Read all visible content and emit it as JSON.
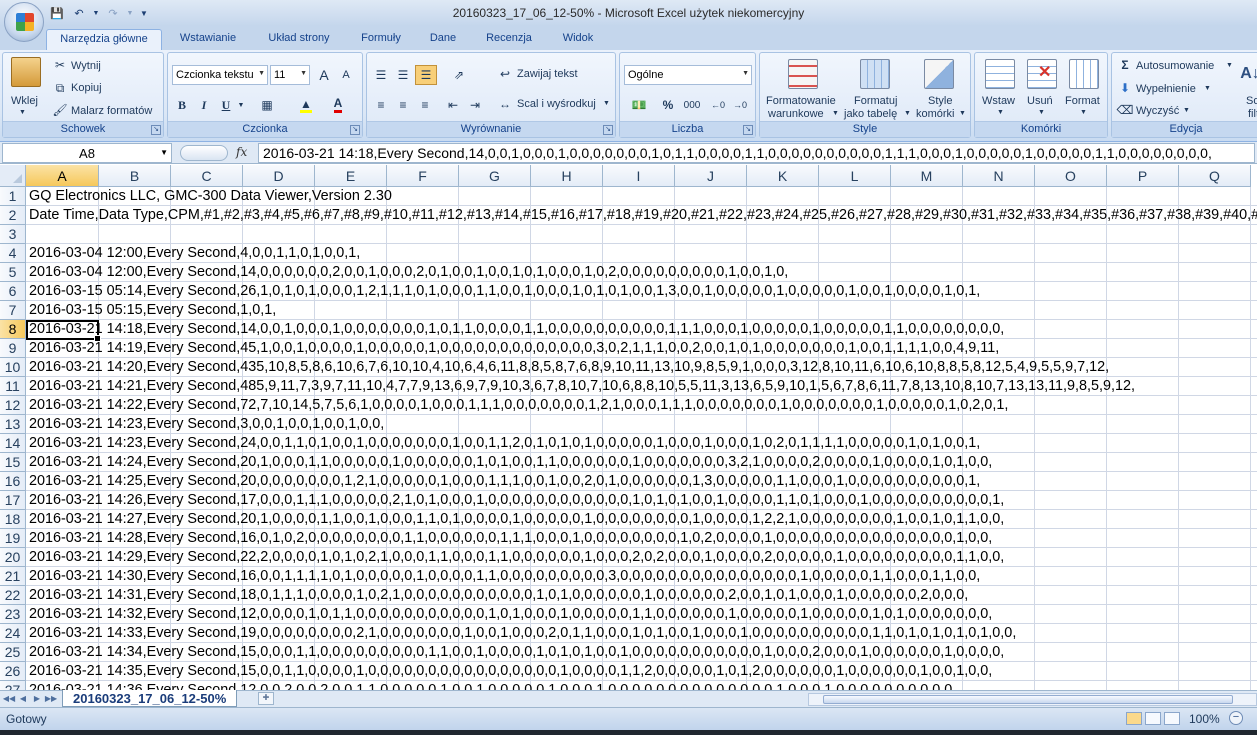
{
  "window": {
    "title": "20160323_17_06_12-50% - Microsoft Excel użytek niekomercyjny"
  },
  "quick_access": {
    "save_icon": "save-icon",
    "undo_icon": "undo-icon",
    "redo_icon": "redo-icon",
    "customize_icon": "customize-qat-icon"
  },
  "ribbon_tabs": [
    {
      "label": "Narzędzia główne",
      "active": true
    },
    {
      "label": "Wstawianie"
    },
    {
      "label": "Układ strony"
    },
    {
      "label": "Formuły"
    },
    {
      "label": "Dane"
    },
    {
      "label": "Recenzja"
    },
    {
      "label": "Widok"
    }
  ],
  "ribbon": {
    "clipboard": {
      "group_label": "Schowek",
      "paste": "Wklej",
      "cut": "Wytnij",
      "copy": "Kopiuj",
      "format_painter": "Malarz formatów"
    },
    "font": {
      "group_label": "Czcionka",
      "font_name": "Czcionka tekstu",
      "font_size": "11",
      "bold": "B",
      "italic": "I",
      "underline": "U",
      "grow": "A",
      "shrink": "A",
      "font_color": "A",
      "font_color_hex": "#e00000",
      "fill_color_hex": "#ffff00"
    },
    "alignment": {
      "group_label": "Wyrównanie",
      "wrap_text": "Zawijaj tekst",
      "merge_center": "Scal i wyśrodkuj"
    },
    "number": {
      "group_label": "Liczba",
      "format": "Ogólne",
      "percent": "%",
      "thousands": "000"
    },
    "styles": {
      "group_label": "Style",
      "conditional_line1": "Formatowanie",
      "conditional_line2": "warunkowe",
      "table_line1": "Formatuj",
      "table_line2": "jako tabelę",
      "cell_styles_line1": "Style",
      "cell_styles_line2": "komórki"
    },
    "cells": {
      "group_label": "Komórki",
      "insert": "Wstaw",
      "delete": "Usuń",
      "format": "Format"
    },
    "editing": {
      "group_label": "Edycja",
      "autosum": "Autosumowanie",
      "fill": "Wypełnienie",
      "clear": "Wyczyść",
      "sort_line1": "Sort",
      "sort_line2": "filtr"
    }
  },
  "formula_bar": {
    "name_box": "A8",
    "fx": "fx",
    "formula": "2016-03-21 14:18,Every Second,14,0,0,1,0,0,0,1,0,0,0,0,0,0,0,1,0,1,1,0,0,0,0,1,1,0,0,0,0,0,0,0,0,0,0,1,1,1,0,0,0,1,0,0,0,0,0,1,0,0,0,0,0,1,1,0,0,0,0,0,0,0,0,"
  },
  "columns": [
    "A",
    "B",
    "C",
    "D",
    "E",
    "F",
    "G",
    "H",
    "I",
    "J",
    "K",
    "L",
    "M",
    "N",
    "O",
    "P",
    "Q"
  ],
  "selected_column": "A",
  "selected_row": "8",
  "rows": [
    {
      "n": "1",
      "text": "GQ Electronics LLC, GMC-300 Data Viewer,Version 2.30"
    },
    {
      "n": "2",
      "text": "Date Time,Data Type,CPM,#1,#2,#3,#4,#5,#6,#7,#8,#9,#10,#11,#12,#13,#14,#15,#16,#17,#18,#19,#20,#21,#22,#23,#24,#25,#26,#27,#28,#29,#30,#31,#32,#33,#34,#35,#36,#37,#38,#39,#40,#"
    },
    {
      "n": "3",
      "text": ""
    },
    {
      "n": "4",
      "text": "2016-03-04 12:00,Every Second,4,0,0,1,1,0,1,0,0,1,"
    },
    {
      "n": "5",
      "text": "2016-03-04 12:00,Every Second,14,0,0,0,0,0,0,2,0,0,1,0,0,0,2,0,1,0,0,1,0,0,1,0,1,0,0,0,1,0,2,0,0,0,0,0,0,0,0,0,1,0,0,1,0,"
    },
    {
      "n": "6",
      "text": "2016-03-15 05:14,Every Second,26,1,0,1,0,1,0,0,0,1,2,1,1,1,0,1,0,0,0,1,1,0,0,1,0,0,0,1,0,1,0,1,0,0,1,3,0,0,1,0,0,0,0,0,1,0,0,0,0,0,1,0,0,1,0,0,0,0,1,0,1,"
    },
    {
      "n": "7",
      "text": "2016-03-15 05:15,Every Second,1,0,1,"
    },
    {
      "n": "8",
      "text": "2016-03-21 14:18,Every Second,14,0,0,1,0,0,0,1,0,0,0,0,0,0,0,1,0,1,1,0,0,0,0,1,1,0,0,0,0,0,0,0,0,0,0,1,1,1,0,0,0,1,0,0,0,0,0,1,0,0,0,0,0,1,1,0,0,0,0,0,0,0,0,"
    },
    {
      "n": "9",
      "text": "2016-03-21 14:19,Every Second,45,1,0,0,1,0,0,0,0,1,0,0,0,0,0,1,0,0,0,0,0,0,0,0,0,0,0,0,0,3,0,2,1,1,1,0,0,2,0,0,1,0,1,0,0,0,0,0,0,0,1,0,0,1,1,1,1,0,0,4,9,11,"
    },
    {
      "n": "10",
      "text": "2016-03-21 14:20,Every Second,435,10,8,5,8,6,10,6,7,6,10,10,4,10,6,4,6,11,8,8,5,8,7,6,8,9,10,11,13,10,9,8,5,9,1,0,0,0,3,12,8,10,11,6,10,6,10,8,8,5,8,12,5,4,9,5,5,9,7,12,"
    },
    {
      "n": "11",
      "text": "2016-03-21 14:21,Every Second,485,9,11,7,3,9,7,11,10,4,7,7,9,13,6,9,7,9,10,3,6,7,8,10,7,10,6,8,8,10,5,5,11,3,13,6,5,9,10,1,5,6,7,8,6,11,7,8,13,10,8,10,7,13,13,11,9,8,5,9,12,"
    },
    {
      "n": "12",
      "text": "2016-03-21 14:22,Every Second,72,7,10,14,5,7,5,6,1,0,0,0,0,1,0,0,0,1,1,1,0,0,0,0,0,0,0,1,2,1,0,0,0,1,1,1,0,0,0,0,0,0,0,1,0,0,0,0,0,0,0,1,0,0,0,0,0,1,0,2,0,1,"
    },
    {
      "n": "13",
      "text": "2016-03-21 14:23,Every Second,3,0,0,1,0,0,1,0,0,1,0,0,"
    },
    {
      "n": "14",
      "text": "2016-03-21 14:23,Every Second,24,0,0,1,1,0,1,0,0,1,0,0,0,0,0,0,0,1,0,0,1,1,2,0,1,0,1,0,1,0,0,0,0,0,1,0,0,0,1,0,0,0,1,0,2,0,1,1,1,1,0,0,0,0,0,1,0,1,0,0,1,"
    },
    {
      "n": "15",
      "text": "2016-03-21 14:24,Every Second,20,1,0,0,0,1,1,0,0,0,0,0,1,0,0,0,0,0,0,1,0,1,0,0,1,1,0,0,0,0,0,0,1,0,0,0,0,0,0,0,3,2,1,0,0,0,0,2,0,0,0,0,1,0,0,0,0,1,0,1,0,0,"
    },
    {
      "n": "16",
      "text": "2016-03-21 14:25,Every Second,20,0,0,0,0,0,0,0,1,2,1,0,0,0,0,0,1,0,0,0,1,1,1,0,0,1,0,0,2,0,1,0,0,0,0,0,0,1,3,0,0,0,0,0,1,1,0,0,0,1,0,0,0,0,0,0,0,0,0,0,1,"
    },
    {
      "n": "17",
      "text": "2016-03-21 14:26,Every Second,17,0,0,0,1,1,1,0,0,0,0,0,2,1,0,1,0,0,0,1,0,0,0,0,0,0,0,0,0,0,0,0,1,0,1,0,1,0,0,1,0,0,0,0,1,1,0,1,0,0,0,1,0,0,0,0,0,0,0,0,0,0,1,"
    },
    {
      "n": "18",
      "text": "2016-03-21 14:27,Every Second,20,1,0,0,0,0,1,1,0,0,1,0,0,0,1,1,0,1,0,0,0,0,1,0,0,0,0,0,1,0,0,0,0,0,0,0,0,1,0,0,0,0,1,2,2,1,0,0,0,0,0,0,0,0,1,0,0,1,0,1,1,0,0,"
    },
    {
      "n": "19",
      "text": "2016-03-21 14:28,Every Second,16,0,1,0,2,0,0,0,0,0,0,0,0,1,1,0,0,0,0,0,0,1,1,1,0,0,0,1,0,0,0,0,0,0,0,0,1,0,2,0,0,0,0,1,0,0,0,0,0,0,0,0,0,0,0,0,0,0,0,1,0,0,"
    },
    {
      "n": "20",
      "text": "2016-03-21 14:29,Every Second,22,2,0,0,0,0,1,0,1,0,2,1,0,0,0,1,1,0,0,0,1,1,0,0,0,0,0,0,1,0,0,0,2,0,2,0,0,0,1,0,0,0,0,2,0,0,0,0,0,1,0,0,0,0,0,0,0,0,0,1,1,0,0,"
    },
    {
      "n": "21",
      "text": "2016-03-21 14:30,Every Second,16,0,0,1,1,1,1,0,1,0,0,0,0,0,1,0,0,0,0,1,1,0,0,0,0,0,0,0,0,0,3,0,0,0,0,0,0,0,0,0,0,0,0,0,0,0,1,0,0,0,0,0,1,1,0,0,0,1,1,0,0,"
    },
    {
      "n": "22",
      "text": "2016-03-21 14:31,Every Second,18,0,1,1,1,0,0,0,0,1,0,2,1,0,0,0,0,0,0,0,0,0,0,0,1,0,1,0,0,0,0,0,0,1,0,0,0,0,0,0,2,0,0,1,0,1,0,0,0,1,0,0,0,0,0,0,2,0,0,0,"
    },
    {
      "n": "23",
      "text": "2016-03-21 14:32,Every Second,12,0,0,0,0,1,0,1,1,0,0,0,0,0,0,0,0,0,0,0,1,0,1,0,0,0,1,0,0,0,0,0,1,1,0,0,0,0,0,0,1,0,0,0,0,0,1,0,0,0,0,0,1,0,1,0,0,0,0,0,0,0,"
    },
    {
      "n": "24",
      "text": "2016-03-21 14:33,Every Second,19,0,0,0,0,0,0,0,0,2,1,0,0,0,0,0,0,0,1,0,0,1,0,0,0,2,0,1,1,0,0,0,1,0,1,0,0,1,0,0,0,1,0,0,0,0,0,0,0,0,0,0,1,1,0,1,0,1,0,1,0,1,0,0,"
    },
    {
      "n": "25",
      "text": "2016-03-21 14:34,Every Second,15,0,0,0,1,1,0,0,0,0,0,0,0,0,0,1,1,0,0,1,0,0,0,0,1,0,1,0,1,0,0,1,0,0,0,0,0,0,0,0,0,0,0,1,0,0,0,2,0,0,0,1,0,0,0,0,0,0,1,0,0,0,0,"
    },
    {
      "n": "26",
      "text": "2016-03-21 14:35,Every Second,15,0,0,1,1,0,0,0,0,1,0,0,0,0,0,0,0,0,0,0,0,0,0,0,0,0,1,0,0,0,0,1,1,2,0,0,0,0,0,1,0,1,2,0,0,0,0,0,0,1,0,0,0,0,0,0,1,0,0,1,0,0,"
    },
    {
      "n": "27",
      "text": "2016-03-21 14:36,Every Second,12,0,0,2,0,0,2,0,0,1,1,0,0,0,0,0,1,0,0,1,0,0,0,0,0,1,0,0,0,1,0,0,0,0,0,0,0,0,0,0,0,0,0,0,1,0,0,0,1,0,0,0,0,0,0,0,0,0,0,"
    }
  ],
  "sheet_tab": "20160323_17_06_12-50%",
  "status": {
    "ready": "Gotowy",
    "zoom": "100%"
  }
}
